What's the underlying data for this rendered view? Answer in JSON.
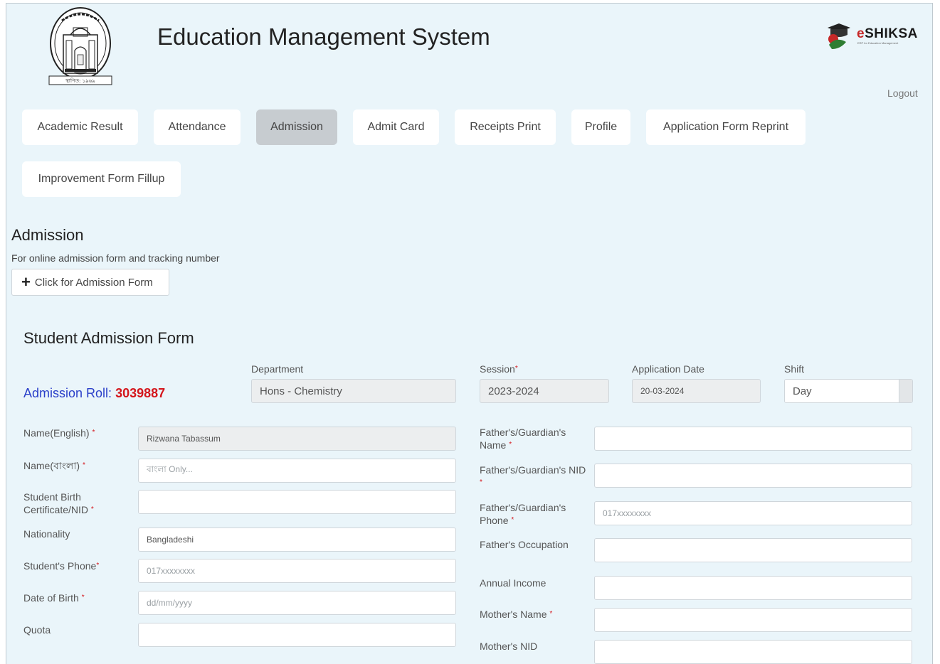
{
  "header": {
    "title": "Education Management System",
    "brand": "eSHIKSA",
    "brand_tagline": "ERP for Education Management",
    "logout": "Logout",
    "logo_caption": "স্থাপিত: ১৯৬৯"
  },
  "nav": {
    "items": [
      {
        "label": "Academic Result"
      },
      {
        "label": "Attendance"
      },
      {
        "label": "Admission",
        "active": true
      },
      {
        "label": "Admit Card"
      },
      {
        "label": "Receipts Print"
      },
      {
        "label": "Profile"
      },
      {
        "label": "Application Form Reprint"
      },
      {
        "label": "Improvement Form Fillup"
      }
    ]
  },
  "admission": {
    "title": "Admission",
    "subtitle": "For online admission form and tracking number",
    "button": "Click for Admission Form"
  },
  "form": {
    "title": "Student Admission Form",
    "roll_label": "Admission Roll:",
    "roll_number": "3039887",
    "department": {
      "label": "Department",
      "value": "Hons - Chemistry"
    },
    "session": {
      "label": "Session",
      "value": "2023-2024"
    },
    "application_date": {
      "label": "Application Date",
      "value": "20-03-2024"
    },
    "shift": {
      "label": "Shift",
      "value": "Day"
    },
    "left_fields": [
      {
        "label": "Name(English)",
        "required": "*",
        "value": "Rizwana Tabassum",
        "placeholder": ""
      },
      {
        "label": "Name(বাংলা)",
        "required": "*",
        "value": "",
        "placeholder": "বাংলা Only..."
      },
      {
        "label": "Student Birth Certificate/NID",
        "required": "*",
        "value": "",
        "placeholder": ""
      },
      {
        "label": "Nationality",
        "required": "",
        "value": "Bangladeshi",
        "placeholder": ""
      },
      {
        "label": "Student's Phone",
        "required": "*",
        "value": "",
        "placeholder": "017xxxxxxxx"
      },
      {
        "label": "Date of Birth",
        "required": "*",
        "value": "",
        "placeholder": "dd/mm/yyyy"
      },
      {
        "label": "Quota",
        "required": "",
        "value": "",
        "placeholder": ""
      }
    ],
    "right_fields": [
      {
        "label": "Father's/Guardian's Name",
        "required": "*",
        "value": "",
        "placeholder": ""
      },
      {
        "label": "Father's/Guardian's NID",
        "required": "*",
        "value": "",
        "placeholder": ""
      },
      {
        "label": "Father's/Guardian's Phone",
        "required": "*",
        "value": "",
        "placeholder": "017xxxxxxxx"
      },
      {
        "label": "Father's Occupation",
        "required": "",
        "value": "",
        "placeholder": ""
      },
      {
        "label": "Annual Income",
        "required": "",
        "value": "",
        "placeholder": ""
      },
      {
        "label": "Mother's Name",
        "required": "*",
        "value": "",
        "placeholder": ""
      },
      {
        "label": "Mother's NID",
        "required": "",
        "value": "",
        "placeholder": ""
      }
    ]
  },
  "colors": {
    "background": "#eaf5fa",
    "roll_label": "#2a3fc9",
    "roll_number": "#d4161c",
    "required": "#d4161c",
    "active_tab": "#c7ccd0"
  }
}
